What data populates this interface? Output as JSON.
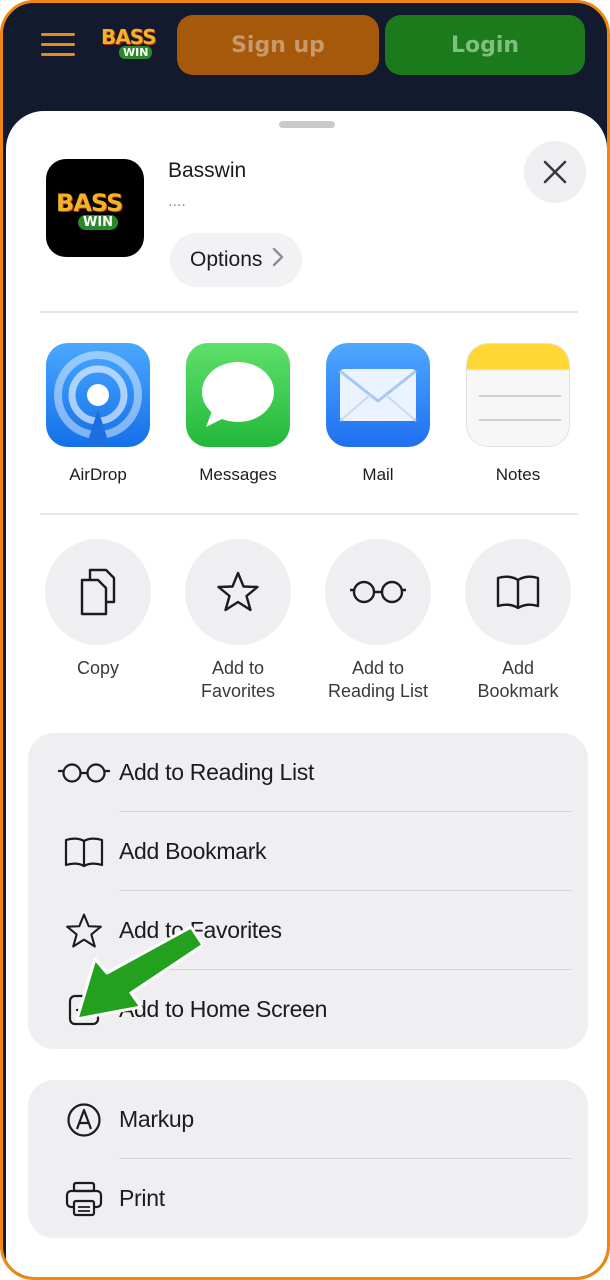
{
  "header": {
    "logo_top": "BASS",
    "logo_bottom": "WIN",
    "signup_label": "Sign up",
    "login_label": "Login"
  },
  "sheet": {
    "app_name": "Basswin",
    "app_subtitle": "....",
    "options_label": "Options",
    "icon_logo_top": "BASS",
    "icon_logo_bottom": "WIN"
  },
  "apps": [
    {
      "label": "AirDrop",
      "icon": "airdrop-icon"
    },
    {
      "label": "Messages",
      "icon": "messages-icon"
    },
    {
      "label": "Mail",
      "icon": "mail-icon"
    },
    {
      "label": "Notes",
      "icon": "notes-icon"
    }
  ],
  "actions": [
    {
      "label": "Copy",
      "icon": "copy-icon"
    },
    {
      "label": "Add to Favorites",
      "icon": "star-icon"
    },
    {
      "label": "Add to Reading List",
      "icon": "glasses-icon"
    },
    {
      "label": "Add Bookmark",
      "icon": "book-icon"
    }
  ],
  "action_labels": {
    "copy": "Copy",
    "fav_line1": "Add to",
    "fav_line2": "Favorites",
    "rl_line1": "Add to",
    "rl_line2": "Reading List",
    "bm_line1": "Add",
    "bm_line2": "Bookmark"
  },
  "list_group_1": [
    {
      "label": "Add to Reading List",
      "icon": "glasses-icon"
    },
    {
      "label": "Add Bookmark",
      "icon": "book-icon"
    },
    {
      "label": "Add to Favorites",
      "icon": "star-icon"
    },
    {
      "label": "Add to Home Screen",
      "icon": "add-square-icon"
    }
  ],
  "list_group_2": [
    {
      "label": "Markup",
      "icon": "markup-icon"
    },
    {
      "label": "Print",
      "icon": "printer-icon"
    }
  ],
  "colors": {
    "frame_border": "#f0860e",
    "header_bg": "#131a2e",
    "signup_bg": "#a6590a",
    "login_bg": "#1b7a1c",
    "arrow_green": "#22a01e"
  }
}
